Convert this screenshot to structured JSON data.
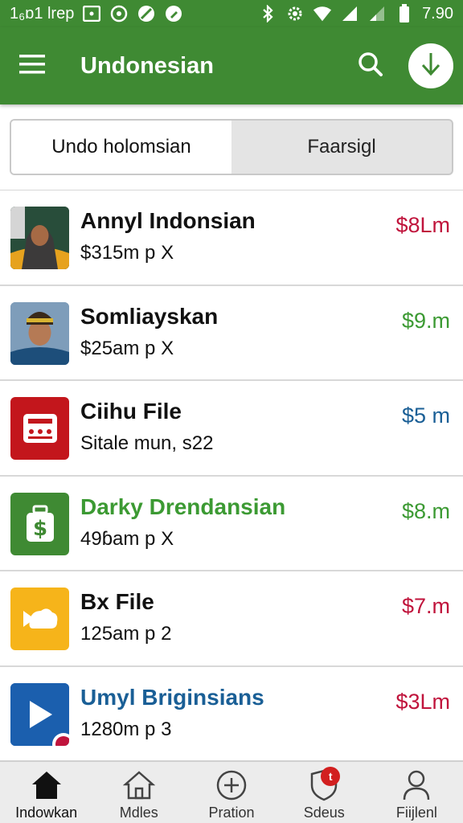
{
  "status_bar": {
    "left_text": "1₆ɒ1 lrep",
    "time": "7.90",
    "left_icons": [
      "photo-icon",
      "sync-icon",
      "block-icon",
      "edit-icon"
    ],
    "right_icons": [
      "bluetooth-icon",
      "settings-icon",
      "wifi-icon",
      "signal-icon",
      "signal-weak-icon",
      "battery-icon"
    ]
  },
  "app_bar": {
    "title": "Undonesian",
    "background": "#3f8a33",
    "icons": [
      "menu-icon",
      "search-icon",
      "download-icon"
    ]
  },
  "tabs": [
    {
      "label": "Undo holomsian",
      "active": true
    },
    {
      "label": "Faarsigl",
      "active": false
    }
  ],
  "list": [
    {
      "title": "Annyl Indonsian",
      "subtitle": "$315m p X",
      "amount": "$8Lm",
      "title_color": "#111111",
      "amount_color": "#c0143c",
      "thumb": "portrait-woman"
    },
    {
      "title": "Somliayskan",
      "subtitle": "$25am p X",
      "amount": "$9.m",
      "title_color": "#111111",
      "amount_color": "#3c9a33",
      "thumb": "portrait-man"
    },
    {
      "title": "Ciihu File",
      "subtitle": "Sitale mun, s22",
      "amount": "$5 m",
      "title_color": "#111111",
      "amount_color": "#1a5f96",
      "thumb": "calculator-icon",
      "thumb_color": "#c3161c"
    },
    {
      "title": "Darky Drendansian",
      "subtitle": "49ɓam p X",
      "amount": "$8.m",
      "title_color": "#3c9a33",
      "amount_color": "#3c9a33",
      "thumb": "money-bag-icon",
      "thumb_color": "#3f8a33"
    },
    {
      "title": "Bx File",
      "subtitle": "125am p 2",
      "amount": "$7.m",
      "title_color": "#111111",
      "amount_color": "#c0143c",
      "thumb": "cloud-arrow-icon",
      "thumb_color": "#f6b41a"
    },
    {
      "title": "Umyl Briginsians",
      "subtitle": "1280m p 3",
      "amount": "$3Lm",
      "title_color": "#1a5f96",
      "amount_color": "#c0143c",
      "thumb": "play-icon",
      "thumb_color": "#1b5fae"
    }
  ],
  "bottom_nav": [
    {
      "label": "Indowkan",
      "icon": "home-icon",
      "active": true
    },
    {
      "label": "Mdles",
      "icon": "home-outline-icon",
      "active": false
    },
    {
      "label": "Pration",
      "icon": "add-circle-icon",
      "active": false
    },
    {
      "label": "Sdeus",
      "icon": "shield-icon",
      "active": false,
      "badge": "t"
    },
    {
      "label": "Fiijlenl",
      "icon": "person-icon",
      "active": false
    }
  ]
}
